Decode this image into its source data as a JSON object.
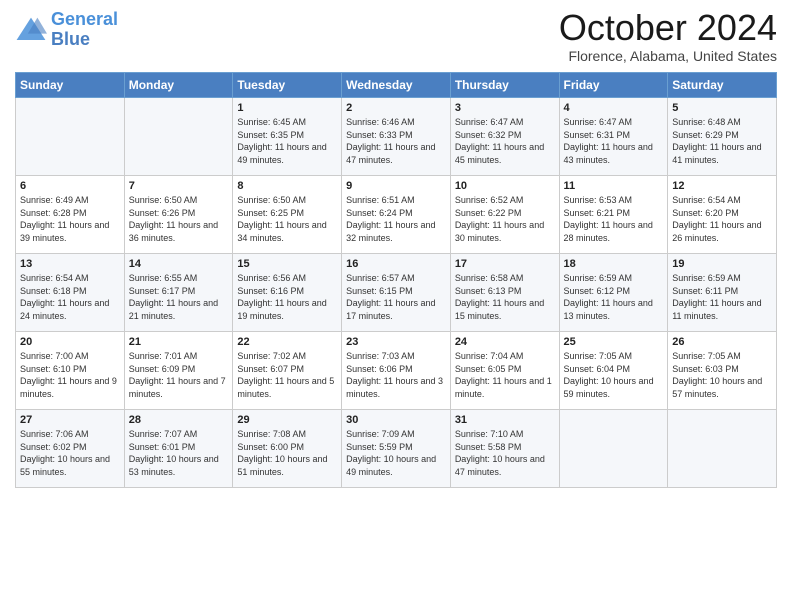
{
  "header": {
    "logo_line1": "General",
    "logo_line2": "Blue",
    "month_title": "October 2024",
    "location": "Florence, Alabama, United States"
  },
  "weekdays": [
    "Sunday",
    "Monday",
    "Tuesday",
    "Wednesday",
    "Thursday",
    "Friday",
    "Saturday"
  ],
  "weeks": [
    [
      {
        "day": "",
        "info": ""
      },
      {
        "day": "",
        "info": ""
      },
      {
        "day": "1",
        "info": "Sunrise: 6:45 AM\nSunset: 6:35 PM\nDaylight: 11 hours and 49 minutes."
      },
      {
        "day": "2",
        "info": "Sunrise: 6:46 AM\nSunset: 6:33 PM\nDaylight: 11 hours and 47 minutes."
      },
      {
        "day": "3",
        "info": "Sunrise: 6:47 AM\nSunset: 6:32 PM\nDaylight: 11 hours and 45 minutes."
      },
      {
        "day": "4",
        "info": "Sunrise: 6:47 AM\nSunset: 6:31 PM\nDaylight: 11 hours and 43 minutes."
      },
      {
        "day": "5",
        "info": "Sunrise: 6:48 AM\nSunset: 6:29 PM\nDaylight: 11 hours and 41 minutes."
      }
    ],
    [
      {
        "day": "6",
        "info": "Sunrise: 6:49 AM\nSunset: 6:28 PM\nDaylight: 11 hours and 39 minutes."
      },
      {
        "day": "7",
        "info": "Sunrise: 6:50 AM\nSunset: 6:26 PM\nDaylight: 11 hours and 36 minutes."
      },
      {
        "day": "8",
        "info": "Sunrise: 6:50 AM\nSunset: 6:25 PM\nDaylight: 11 hours and 34 minutes."
      },
      {
        "day": "9",
        "info": "Sunrise: 6:51 AM\nSunset: 6:24 PM\nDaylight: 11 hours and 32 minutes."
      },
      {
        "day": "10",
        "info": "Sunrise: 6:52 AM\nSunset: 6:22 PM\nDaylight: 11 hours and 30 minutes."
      },
      {
        "day": "11",
        "info": "Sunrise: 6:53 AM\nSunset: 6:21 PM\nDaylight: 11 hours and 28 minutes."
      },
      {
        "day": "12",
        "info": "Sunrise: 6:54 AM\nSunset: 6:20 PM\nDaylight: 11 hours and 26 minutes."
      }
    ],
    [
      {
        "day": "13",
        "info": "Sunrise: 6:54 AM\nSunset: 6:18 PM\nDaylight: 11 hours and 24 minutes."
      },
      {
        "day": "14",
        "info": "Sunrise: 6:55 AM\nSunset: 6:17 PM\nDaylight: 11 hours and 21 minutes."
      },
      {
        "day": "15",
        "info": "Sunrise: 6:56 AM\nSunset: 6:16 PM\nDaylight: 11 hours and 19 minutes."
      },
      {
        "day": "16",
        "info": "Sunrise: 6:57 AM\nSunset: 6:15 PM\nDaylight: 11 hours and 17 minutes."
      },
      {
        "day": "17",
        "info": "Sunrise: 6:58 AM\nSunset: 6:13 PM\nDaylight: 11 hours and 15 minutes."
      },
      {
        "day": "18",
        "info": "Sunrise: 6:59 AM\nSunset: 6:12 PM\nDaylight: 11 hours and 13 minutes."
      },
      {
        "day": "19",
        "info": "Sunrise: 6:59 AM\nSunset: 6:11 PM\nDaylight: 11 hours and 11 minutes."
      }
    ],
    [
      {
        "day": "20",
        "info": "Sunrise: 7:00 AM\nSunset: 6:10 PM\nDaylight: 11 hours and 9 minutes."
      },
      {
        "day": "21",
        "info": "Sunrise: 7:01 AM\nSunset: 6:09 PM\nDaylight: 11 hours and 7 minutes."
      },
      {
        "day": "22",
        "info": "Sunrise: 7:02 AM\nSunset: 6:07 PM\nDaylight: 11 hours and 5 minutes."
      },
      {
        "day": "23",
        "info": "Sunrise: 7:03 AM\nSunset: 6:06 PM\nDaylight: 11 hours and 3 minutes."
      },
      {
        "day": "24",
        "info": "Sunrise: 7:04 AM\nSunset: 6:05 PM\nDaylight: 11 hours and 1 minute."
      },
      {
        "day": "25",
        "info": "Sunrise: 7:05 AM\nSunset: 6:04 PM\nDaylight: 10 hours and 59 minutes."
      },
      {
        "day": "26",
        "info": "Sunrise: 7:05 AM\nSunset: 6:03 PM\nDaylight: 10 hours and 57 minutes."
      }
    ],
    [
      {
        "day": "27",
        "info": "Sunrise: 7:06 AM\nSunset: 6:02 PM\nDaylight: 10 hours and 55 minutes."
      },
      {
        "day": "28",
        "info": "Sunrise: 7:07 AM\nSunset: 6:01 PM\nDaylight: 10 hours and 53 minutes."
      },
      {
        "day": "29",
        "info": "Sunrise: 7:08 AM\nSunset: 6:00 PM\nDaylight: 10 hours and 51 minutes."
      },
      {
        "day": "30",
        "info": "Sunrise: 7:09 AM\nSunset: 5:59 PM\nDaylight: 10 hours and 49 minutes."
      },
      {
        "day": "31",
        "info": "Sunrise: 7:10 AM\nSunset: 5:58 PM\nDaylight: 10 hours and 47 minutes."
      },
      {
        "day": "",
        "info": ""
      },
      {
        "day": "",
        "info": ""
      }
    ]
  ]
}
